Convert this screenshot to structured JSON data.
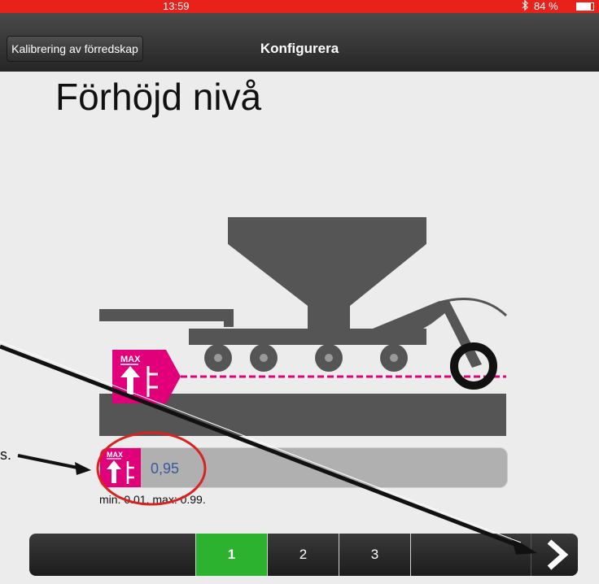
{
  "status_bar": {
    "time": "13:59",
    "bluetooth_icon": "bluetooth-icon",
    "battery": "84 %"
  },
  "nav": {
    "back_label": "Kalibrering av förredskap",
    "title": "Konfigurera"
  },
  "page": {
    "title": "Förhöjd nivå"
  },
  "badge": {
    "label": "MAX"
  },
  "input": {
    "value": "0,95"
  },
  "range": {
    "text": "min: 0.01. max: 0.99."
  },
  "stepper": {
    "steps": [
      {
        "label": "1",
        "active": true
      },
      {
        "label": "2",
        "active": false
      },
      {
        "label": "3",
        "active": false
      }
    ],
    "next_icon": "chevron-right-icon"
  },
  "annotation": {
    "left_fragment": "s."
  },
  "colors": {
    "accent": "#e2007a",
    "active_step": "#2db230",
    "status_bar": "#e8211a"
  }
}
